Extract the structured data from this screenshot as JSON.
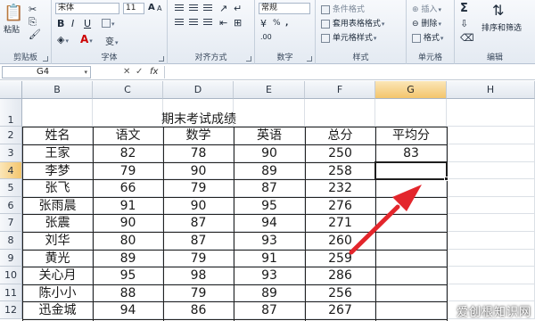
{
  "ribbon": {
    "clipboard": {
      "label": "剪贴板",
      "paste": "粘贴"
    },
    "font": {
      "label": "字体",
      "name": "宋体",
      "size": "11",
      "bold": "B",
      "italic": "I",
      "underline": "U",
      "grow": "A",
      "shrink": "A",
      "color_a": "A",
      "phonetic": "变"
    },
    "alignment": {
      "label": "对齐方式"
    },
    "number": {
      "label": "数字",
      "format": "常规",
      "percent": "%",
      "comma": ",",
      "decimals": ".00"
    },
    "styles": {
      "label": "样式",
      "conditional": "条件格式",
      "table": "套用表格格式",
      "cell": "单元格样式"
    },
    "cells": {
      "label": "单元格",
      "insert": "插入",
      "delete": "删除",
      "format": "格式"
    },
    "editing": {
      "label": "编辑",
      "sum": "Σ",
      "sort": "排序和筛选"
    },
    "accent_color": "#f3c56c",
    "arrow_color": "#e3262c"
  },
  "formula_bar": {
    "name_box": "G4",
    "cancel": "✕",
    "enter": "✓",
    "fx": "fx",
    "value": ""
  },
  "columns": [
    "B",
    "C",
    "D",
    "E",
    "F",
    "G",
    "H"
  ],
  "rows": [
    "1",
    "2",
    "3",
    "4",
    "5",
    "6",
    "7",
    "8",
    "9",
    "10",
    "11",
    "12"
  ],
  "sheet": {
    "title": "期末考试成绩",
    "headers": [
      "姓名",
      "语文",
      "数学",
      "英语",
      "总分",
      "平均分"
    ],
    "data": [
      [
        "王家",
        "82",
        "78",
        "90",
        "250",
        "83"
      ],
      [
        "李梦",
        "79",
        "90",
        "89",
        "258",
        ""
      ],
      [
        "张飞",
        "66",
        "79",
        "87",
        "232",
        ""
      ],
      [
        "张雨晨",
        "91",
        "90",
        "95",
        "276",
        ""
      ],
      [
        "张震",
        "90",
        "87",
        "94",
        "271",
        ""
      ],
      [
        "刘华",
        "80",
        "87",
        "93",
        "260",
        ""
      ],
      [
        "黄光",
        "89",
        "79",
        "91",
        "259",
        ""
      ],
      [
        "关心月",
        "95",
        "98",
        "93",
        "286",
        ""
      ],
      [
        "陈小小",
        "88",
        "79",
        "89",
        "256",
        ""
      ],
      [
        "迅金城",
        "94",
        "86",
        "87",
        "267",
        ""
      ]
    ]
  },
  "selected_cell": "G4",
  "watermark": "爱创根知识网"
}
